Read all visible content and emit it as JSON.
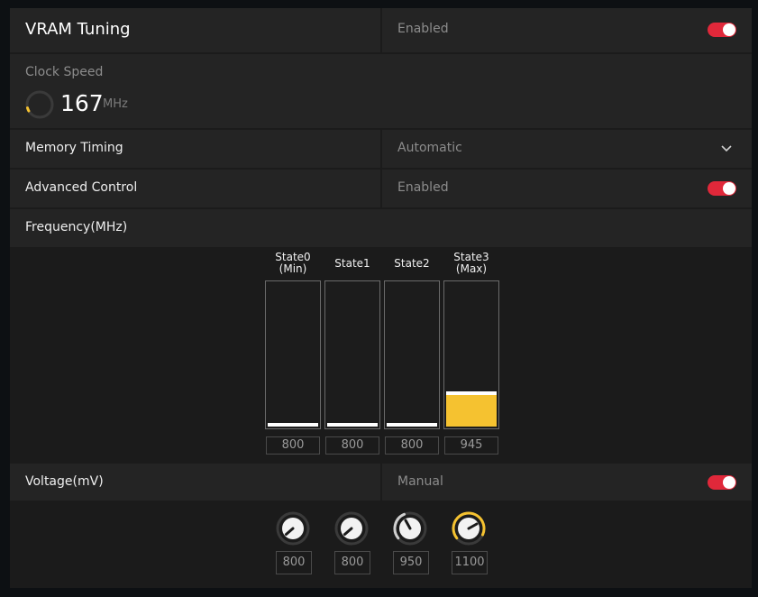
{
  "header": {
    "title": "VRAM Tuning",
    "status": "Enabled",
    "toggle_on": true
  },
  "clock": {
    "label": "Clock Speed",
    "value": "167",
    "unit": "MHz"
  },
  "memory_timing": {
    "label": "Memory Timing",
    "value": "Automatic"
  },
  "advanced_control": {
    "label": "Advanced Control",
    "status": "Enabled",
    "toggle_on": true
  },
  "frequency": {
    "label": "Frequency(MHz)",
    "states": [
      {
        "name": "State0",
        "sub": "(Min)",
        "value": "800",
        "level": 0.0
      },
      {
        "name": "State1",
        "sub": "",
        "value": "800",
        "level": 0.0
      },
      {
        "name": "State2",
        "sub": "",
        "value": "800",
        "level": 0.0
      },
      {
        "name": "State3",
        "sub": "(Max)",
        "value": "945",
        "level": 0.22
      }
    ]
  },
  "voltage": {
    "label": "Voltage(mV)",
    "mode": "Manual",
    "toggle_on": true,
    "knobs": [
      {
        "value": "800"
      },
      {
        "value": "800"
      },
      {
        "value": "950"
      },
      {
        "value": "1100"
      }
    ]
  },
  "colors": {
    "accent_red": "#e0283a",
    "accent_yellow": "#f5c230"
  }
}
